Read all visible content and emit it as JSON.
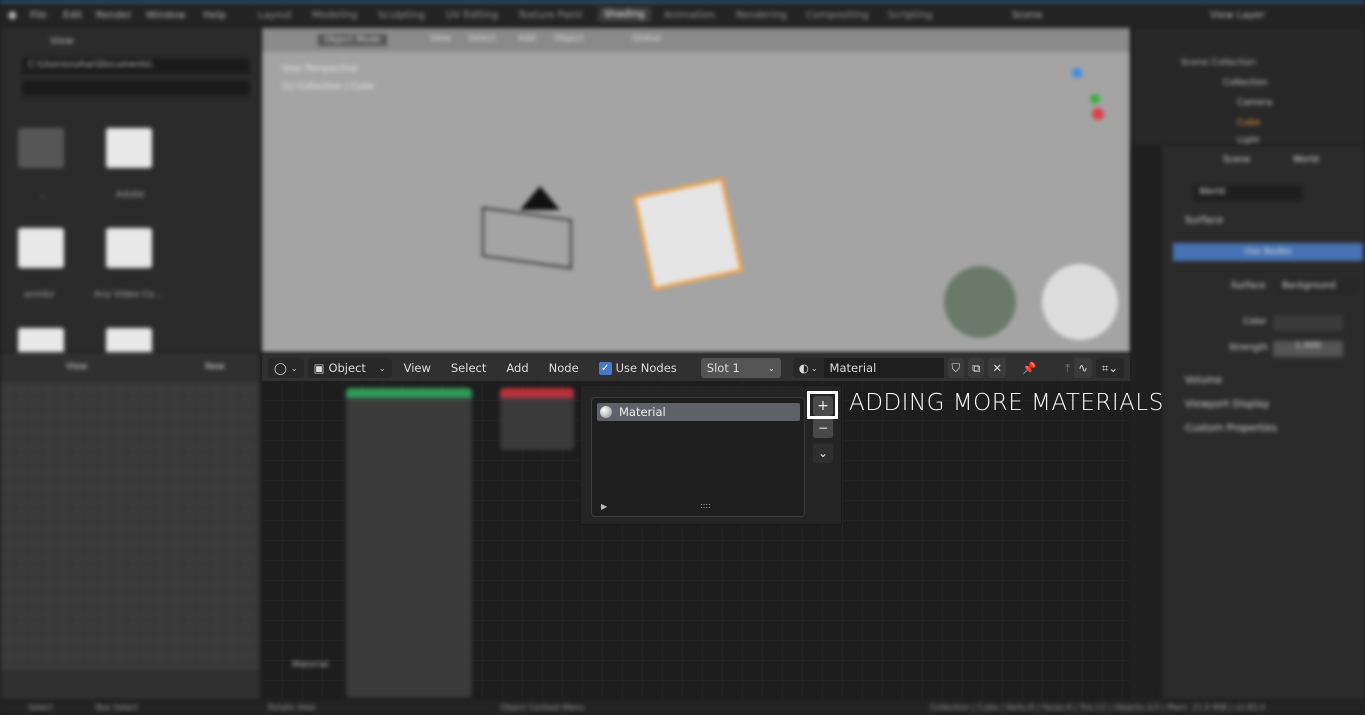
{
  "topbar": {
    "menus": [
      "File",
      "Edit",
      "Render",
      "Window",
      "Help"
    ],
    "workspaces": [
      "Layout",
      "Modeling",
      "Sculpting",
      "UV Editing",
      "Texture Paint",
      "Shading",
      "Animation",
      "Rendering",
      "Compositing",
      "Scripting"
    ],
    "active_workspace": "Shading",
    "scene": "Scene",
    "view_layer": "View Layer"
  },
  "filebrowser": {
    "path": "C:\\Users\\nuhar\\Documents\\",
    "view": "View",
    "folders": [
      "..",
      "Adobe",
      "anmkz",
      "Any Video Co..."
    ]
  },
  "viewport": {
    "mode": "Object Mode",
    "menus": [
      "View",
      "Select",
      "Add",
      "Object"
    ],
    "transform": "Global",
    "overlay_line1": "User Perspective",
    "overlay_line2": "(1) Collection | Cube"
  },
  "outliner": {
    "title": "Scene Collection",
    "items": [
      "Collection",
      "Camera",
      "Cube",
      "Light"
    ]
  },
  "properties": {
    "tabs": [
      "Scene",
      "World"
    ],
    "world_name": "World",
    "section_surface": "Surface",
    "use_nodes": "Use Nodes",
    "surface_label": "Surface",
    "surface_value": "Background",
    "color_label": "Color",
    "strength_label": "Strength",
    "strength_value": "1.000",
    "sections": [
      "Volume",
      "Viewport Display",
      "Custom Properties"
    ]
  },
  "imgeditor": {
    "view": "View",
    "new": "New"
  },
  "node_editor": {
    "editor_type_icon": "node-editor-icon",
    "object_label": "Object",
    "menus": [
      "View",
      "Select",
      "Add",
      "Node"
    ],
    "use_nodes_label": "Use Nodes",
    "use_nodes_checked": true,
    "slot": "Slot 1",
    "material_name": "Material",
    "frame_label": "Material"
  },
  "slot_popup": {
    "materials": [
      "Material"
    ],
    "add_btn": "+",
    "remove_btn": "−",
    "more_btn": "⌄",
    "expand": "▶",
    "grip": "::::"
  },
  "annotation": "ADDING MORE MATERIALS",
  "statusbar": {
    "left": "Select",
    "mid": "Box Select",
    "rotate": "Rotate View",
    "context": "Object Context Menu",
    "stats": "Collection | Cube | Verts:8 | Faces:6 | Tris:12 | Objects:1/3 | Mem: 21.9 MiB | v2.83.0"
  }
}
